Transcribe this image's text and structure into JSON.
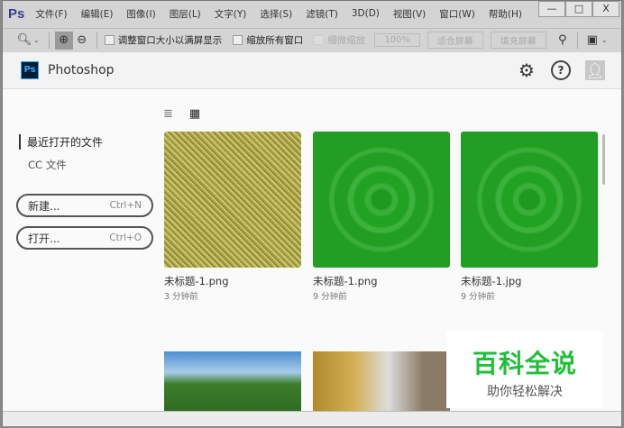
{
  "app": {
    "logo": "Ps",
    "menu": [
      "文件(F)",
      "编辑(E)",
      "图像(I)",
      "图层(L)",
      "文字(Y)",
      "选择(S)",
      "滤镜(T)",
      "3D(D)",
      "视图(V)",
      "窗口(W)",
      "帮助(H)"
    ],
    "win_min": "—",
    "win_max": "□",
    "win_close": "X"
  },
  "toolbar": {
    "resize_windows": "调整窗口大小以满屏显示",
    "zoom_all": "缩放所有窗口",
    "scrubby": "细微缩放",
    "zoom_pct": "100%",
    "fit_screen": "适合屏幕",
    "fill_screen": "填充屏幕"
  },
  "header": {
    "logo": "Ps",
    "title": "Photoshop"
  },
  "sidebar": {
    "recent": "最近打开的文件",
    "cc": "CC 文件",
    "new_label": "新建...",
    "new_shortcut": "Ctrl+N",
    "open_label": "打开...",
    "open_shortcut": "Ctrl+O"
  },
  "files": [
    {
      "name": "未标题-1.png",
      "time": "3 分钟前"
    },
    {
      "name": "未标题-1.png",
      "time": "9 分钟前"
    },
    {
      "name": "未标题-1.jpg",
      "time": "9 分钟前"
    }
  ],
  "watermark": {
    "title": "百科全说",
    "subtitle": "助你轻松解决"
  }
}
